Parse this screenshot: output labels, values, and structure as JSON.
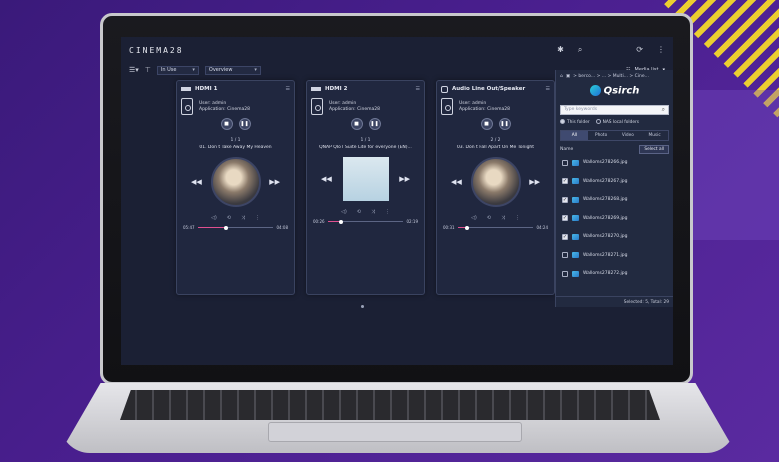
{
  "app": {
    "logo": "CINEMA28"
  },
  "toolbar": {
    "filter_value": "In Use",
    "view_value": "Overview",
    "media_list_label": "Media list"
  },
  "cards": [
    {
      "title": "HDMI 1",
      "user": "User: admin",
      "application": "Application: Cinema28",
      "track_num": "1 / 1",
      "track_name": "01. Don t Take Away My Heaven",
      "time_current": "05:47",
      "time_total": "04:08",
      "progress": 0.38
    },
    {
      "title": "HDMI 2",
      "user": "User: admin",
      "application": "Application: Cinema28",
      "track_num": "1 / 1",
      "track_name": "QNAP QIoT Suite Lite for everyone (EN)...",
      "time_current": "00:26",
      "time_total": "02:19",
      "progress": 0.18
    },
    {
      "title": "Audio Line Out/Speaker",
      "user": "User: admin",
      "application": "Application: Cinema28",
      "track_num": "2 / 2",
      "track_name": "03. Don t Fall Apart On Me Tonight",
      "time_current": "00:31",
      "time_total": "04:24",
      "progress": 0.12
    }
  ],
  "qsirch": {
    "breadcrumb": "> berco... > ... > Multi... > Cine...",
    "brand": "Qsirch",
    "search_placeholder": "Type keywords",
    "radio_this_folder": "This folder",
    "radio_nas": "NAS local folders",
    "tabs": [
      "All",
      "Photo",
      "Video",
      "Music"
    ],
    "column_name": "Name",
    "select_all": "Select all",
    "files": [
      {
        "name": "Walloms278266.jpg",
        "checked": false
      },
      {
        "name": "Walloms278267.jpg",
        "checked": true
      },
      {
        "name": "Walloms278268.jpg",
        "checked": true
      },
      {
        "name": "Walloms278269.jpg",
        "checked": true
      },
      {
        "name": "Walloms278270.jpg",
        "checked": true
      },
      {
        "name": "Walloms278271.jpg",
        "checked": false
      },
      {
        "name": "Walloms278272.jpg",
        "checked": false
      }
    ],
    "footer": "Selected: 5, Total: 29"
  }
}
